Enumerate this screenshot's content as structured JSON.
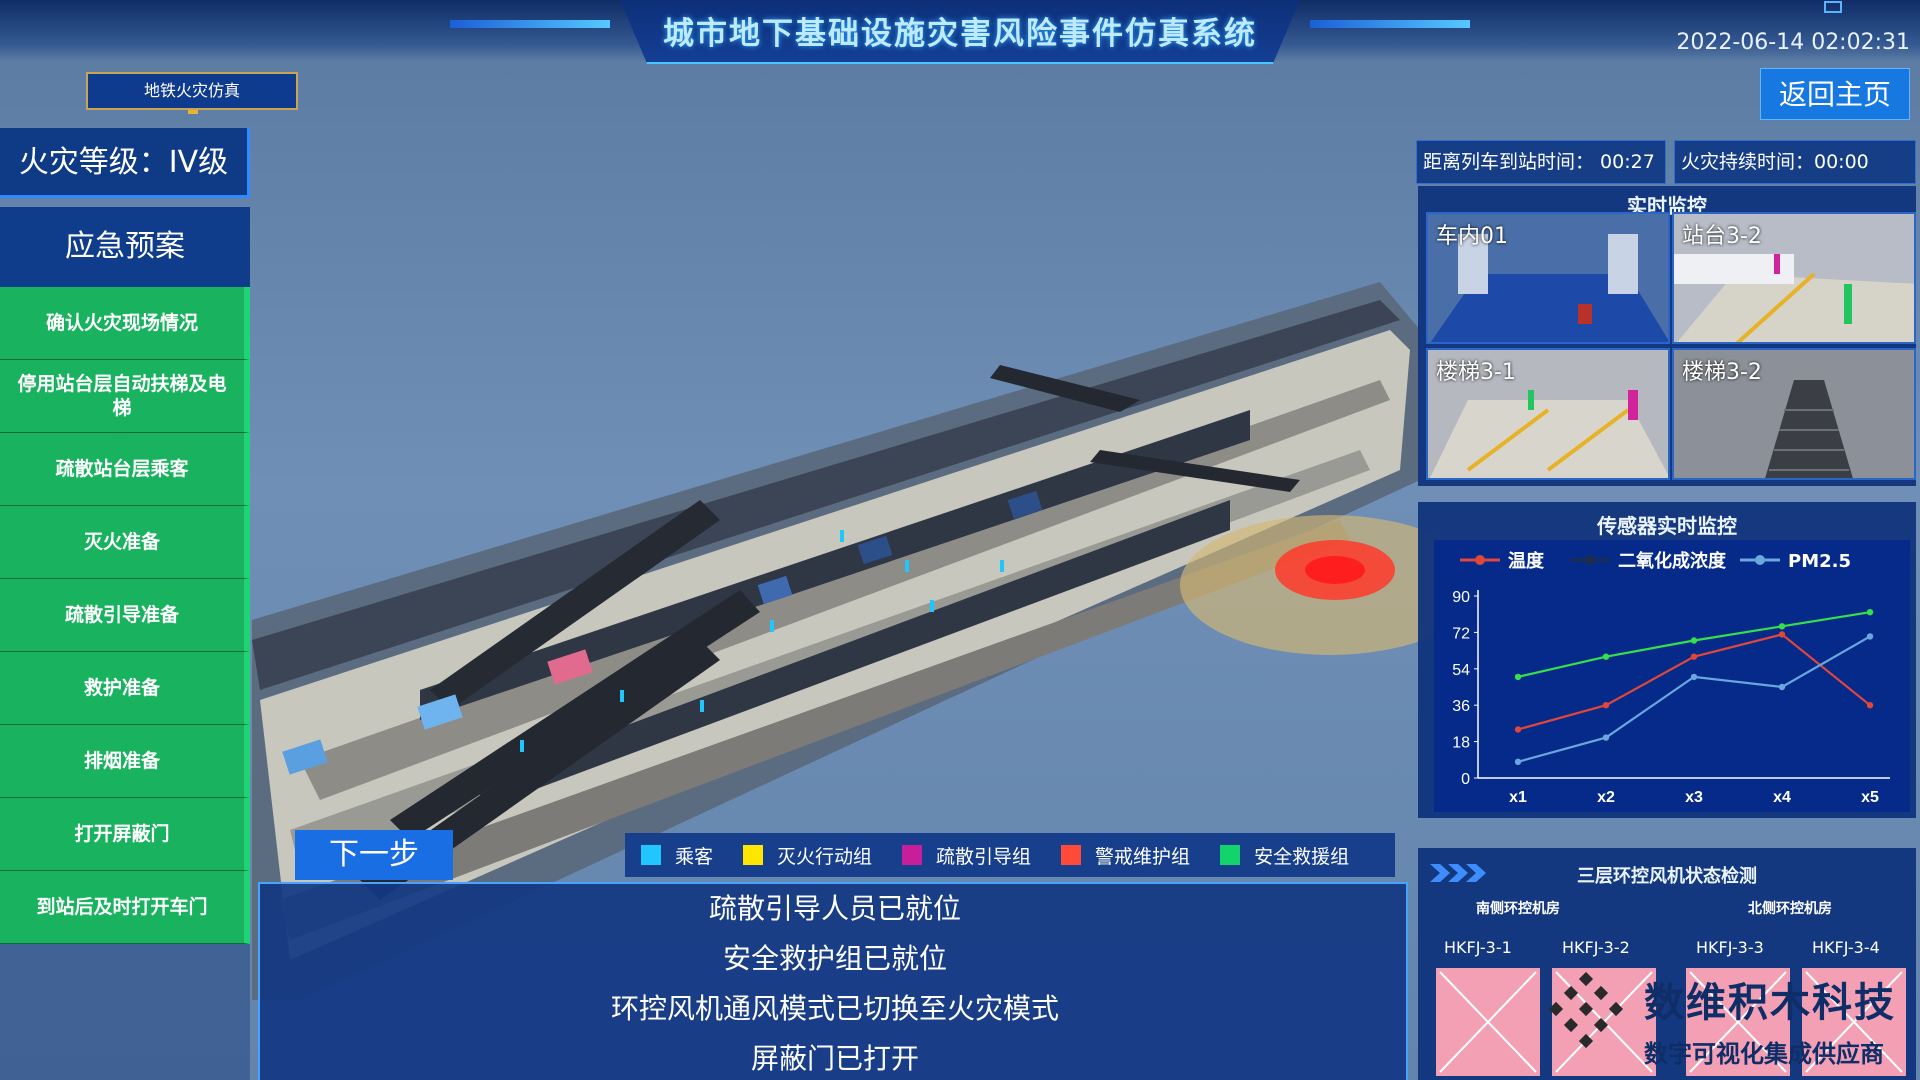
{
  "header": {
    "title": "城市地下基础设施灾害风险事件仿真系统",
    "datetime": "2022-06-14 02:02:31",
    "home_label": "返回主页",
    "mode_tab": "地铁火灾仿真"
  },
  "sidebar": {
    "fire_level": "火灾等级：IV级",
    "plan_title": "应急预案",
    "items": [
      {
        "label": "确认火灾现场情况"
      },
      {
        "label": "停用站台层自动扶梯及电梯"
      },
      {
        "label": "疏散站台层乘客"
      },
      {
        "label": "灭火准备"
      },
      {
        "label": "疏散引导准备"
      },
      {
        "label": "救护准备"
      },
      {
        "label": "排烟准备"
      },
      {
        "label": "打开屏蔽门"
      },
      {
        "label": "到站后及时打开车门"
      }
    ]
  },
  "controls": {
    "next_label": "下一步"
  },
  "legend": [
    {
      "label": "乘客",
      "color": "#22c6ff"
    },
    {
      "label": "灭火行动组",
      "color": "#ffe600"
    },
    {
      "label": "疏散引导组",
      "color": "#c81e9c"
    },
    {
      "label": "警戒维护组",
      "color": "#ff4a3a"
    },
    {
      "label": "安全救援组",
      "color": "#13d46a"
    }
  ],
  "log": [
    "疏散引导人员已就位",
    "安全救护组已就位",
    "环控风机通风模式已切换至火灾模式",
    "屏蔽门已打开"
  ],
  "timers": {
    "arrival": "距离列车到站时间：  00:27",
    "duration": "火灾持续时间：00:00"
  },
  "monitor": {
    "title": "实时监控",
    "cams": [
      {
        "label": "车内01"
      },
      {
        "label": "站台3-2"
      },
      {
        "label": "楼梯3-1"
      },
      {
        "label": "楼梯3-2"
      }
    ]
  },
  "sensor": {
    "title": "传感器实时监控",
    "chart_data": {
      "type": "line",
      "categories": [
        "x1",
        "x2",
        "x3",
        "x4",
        "x5"
      ],
      "ylim": [
        0,
        90
      ],
      "yticks": [
        0,
        18,
        36,
        54,
        72,
        90
      ],
      "legend_position": "top",
      "series": [
        {
          "name": "温度",
          "color": "#e0463a",
          "values": [
            24,
            36,
            60,
            71,
            36
          ]
        },
        {
          "name": "二氧化成浓度",
          "color": "#1b2f4d",
          "values": [
            50,
            60,
            68,
            75,
            82
          ]
        },
        {
          "name": "PM2.5",
          "color": "#6aa7de",
          "values": [
            8,
            20,
            50,
            45,
            70
          ]
        }
      ],
      "extra_line_color": "#36e04a"
    }
  },
  "fans": {
    "title": "三层环控风机状态检测",
    "south_label": "南侧环控机房",
    "north_label": "北侧环控机房",
    "units": [
      "HKFJ-3-1",
      "HKFJ-3-2",
      "HKFJ-3-3",
      "HKFJ-3-4"
    ]
  },
  "watermark": {
    "main": "数维积木科技",
    "sub": "数字可视化集成供应商"
  }
}
